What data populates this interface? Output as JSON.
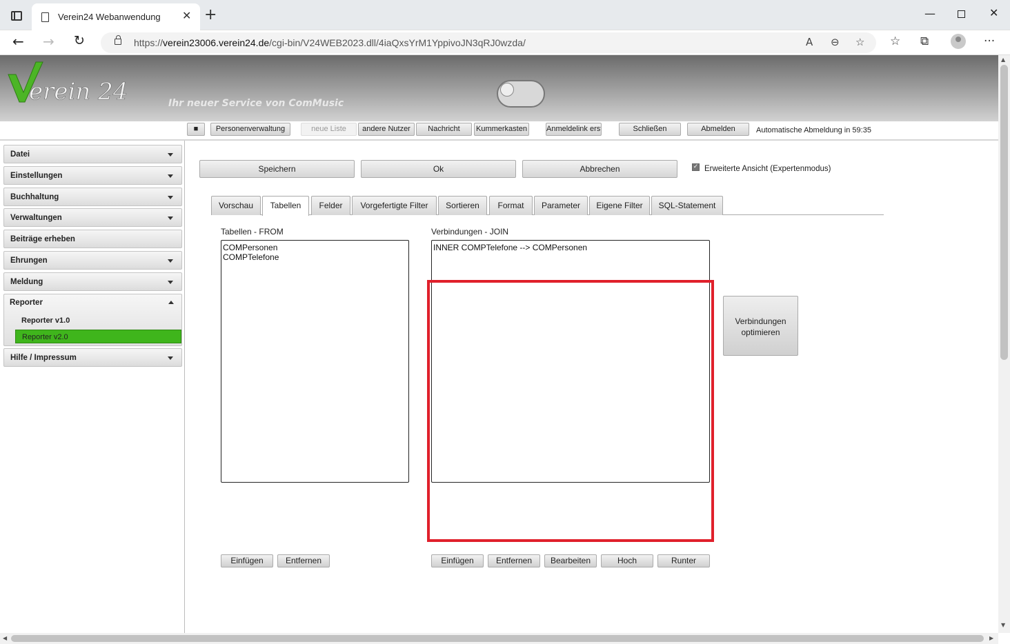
{
  "browser": {
    "tab_title": "Verein24 Webanwendung",
    "url_prefix": "https://",
    "url_host": "verein23006.verein24.de",
    "url_path": "/cgi-bin/V24WEB2023.dll/4iaQxsYrM1YppivoJN3qRJ0wzda/"
  },
  "header": {
    "logo_text": "erein 24",
    "logo_letter": "V",
    "slogan": "Ihr neuer Service von ComMusic"
  },
  "menubar": {
    "stop_label": "■",
    "buttons": [
      "Personenverwaltung",
      "neue Liste",
      "andere Nutzer",
      "Nachricht",
      "Kummerkasten",
      "Anmeldelink erst",
      "Schließen",
      "Abmelden"
    ],
    "status": "Automatische Abmeldung in 59:35"
  },
  "sidebar": {
    "items": [
      "Datei",
      "Einstellungen",
      "Buchhaltung",
      "Verwaltungen",
      "Beiträge erheben",
      "Ehrungen",
      "Meldung",
      "Reporter",
      "Hilfe / Impressum"
    ],
    "reporter_sub": [
      "Reporter v1.0",
      "Reporter v2.0"
    ]
  },
  "actions": {
    "save": "Speichern",
    "ok": "Ok",
    "cancel": "Abbrechen",
    "expert_checkbox_label": "Erweiterte Ansicht (Expertenmodus)",
    "expert_checked": true
  },
  "tabs": [
    "Vorschau",
    "Tabellen",
    "Felder",
    "Vorgefertigte Filter",
    "Sortieren",
    "Format",
    "Parameter",
    "Eigene Filter",
    "SQL-Statement"
  ],
  "active_tab": "Tabellen",
  "tables_panel": {
    "label": "Tabellen - FROM",
    "items": [
      "COMPersonen",
      "COMPTelefone"
    ],
    "buttons": [
      "Einfügen",
      "Entfernen"
    ]
  },
  "joins_panel": {
    "label": "Verbindungen - JOIN",
    "items": [
      "INNER COMPTelefone --> COMPersonen"
    ],
    "buttons": [
      "Einfügen",
      "Entfernen",
      "Bearbeiten",
      "Hoch",
      "Runter"
    ],
    "optimize_line1": "Verbindungen",
    "optimize_line2": "optimieren",
    "highlight_color": "#e0202b"
  },
  "colors": {
    "accent_green": "#3fb51c"
  }
}
